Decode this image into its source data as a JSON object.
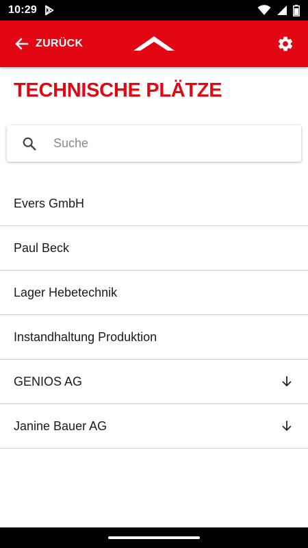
{
  "status_bar": {
    "time": "10:29",
    "icons": [
      "play-store-icon",
      "wifi-icon",
      "cellular-signal-icon",
      "battery-icon"
    ]
  },
  "app_bar": {
    "back_label": "ZURÜCK",
    "back_icon": "arrow-left-icon",
    "logo_icon": "roof-logo-icon",
    "settings_icon": "gear-icon",
    "background_color": "#e30613"
  },
  "page": {
    "title": "TECHNISCHE PLÄTZE"
  },
  "search": {
    "placeholder": "Suche",
    "value": "",
    "icon": "search-icon"
  },
  "list": {
    "items": [
      {
        "label": "Evers GmbH",
        "expandable": false
      },
      {
        "label": "Paul Beck",
        "expandable": false
      },
      {
        "label": "Lager Hebetechnik",
        "expandable": false
      },
      {
        "label": "Instandhaltung Produktion",
        "expandable": false
      },
      {
        "label": "GENIOS AG",
        "expandable": true,
        "icon": "arrow-down-icon"
      },
      {
        "label": "Janine Bauer AG",
        "expandable": true,
        "icon": "arrow-down-icon"
      }
    ]
  }
}
